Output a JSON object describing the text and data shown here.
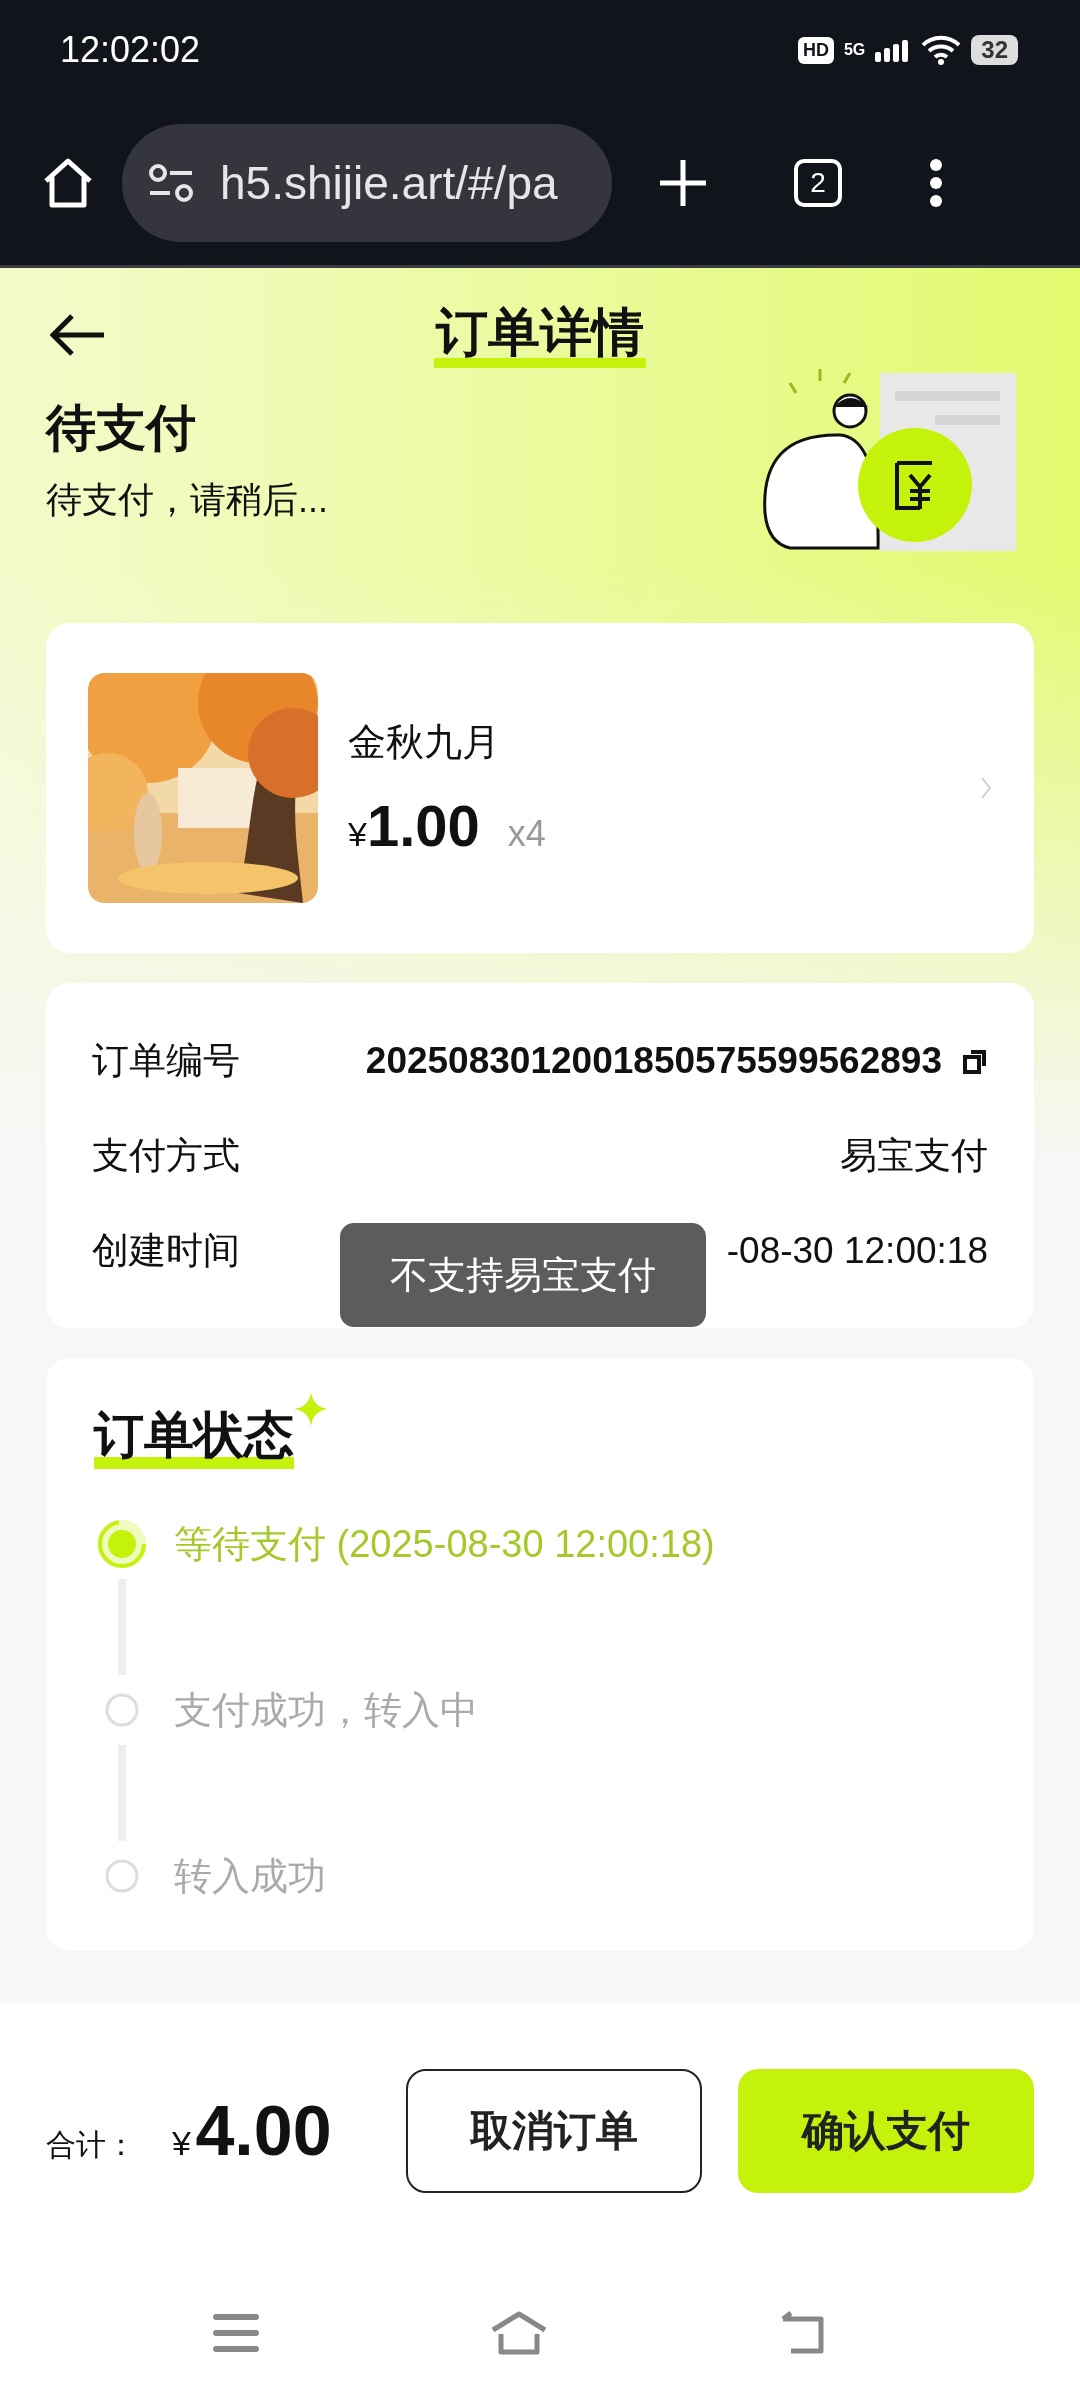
{
  "status_bar": {
    "time": "12:02:02",
    "hd_badge": "HD",
    "network": "5G",
    "battery": "32"
  },
  "browser": {
    "url": "h5.shijie.art/#/pa",
    "tab_count": "2"
  },
  "header": {
    "title": "订单详情"
  },
  "status_banner": {
    "title": "待支付",
    "subtitle": "待支付，请稍后..."
  },
  "product": {
    "name": "金秋九月",
    "currency": "¥",
    "price": "1.00",
    "quantity": "x4"
  },
  "order_info": [
    {
      "label": "订单编号",
      "value": "2025083012001850575599562893",
      "kind": "copyable"
    },
    {
      "label": "支付方式",
      "value": "易宝支付",
      "kind": "plain"
    },
    {
      "label": "创建时间",
      "value": "-08-30 12:00:18",
      "kind": "plain"
    }
  ],
  "toast": "不支持易宝支付",
  "order_status": {
    "title": "订单状态",
    "steps": [
      {
        "label": "等待支付 (2025-08-30 12:00:18)",
        "active": true
      },
      {
        "label": "支付成功，转入中",
        "active": false
      },
      {
        "label": "转入成功",
        "active": false
      }
    ]
  },
  "footer": {
    "total_label": "合计：",
    "currency": "¥",
    "total": "4.00",
    "buttons": [
      {
        "label": "取消订单",
        "kind": "outline"
      },
      {
        "label": "确认支付",
        "kind": "primary"
      }
    ]
  }
}
